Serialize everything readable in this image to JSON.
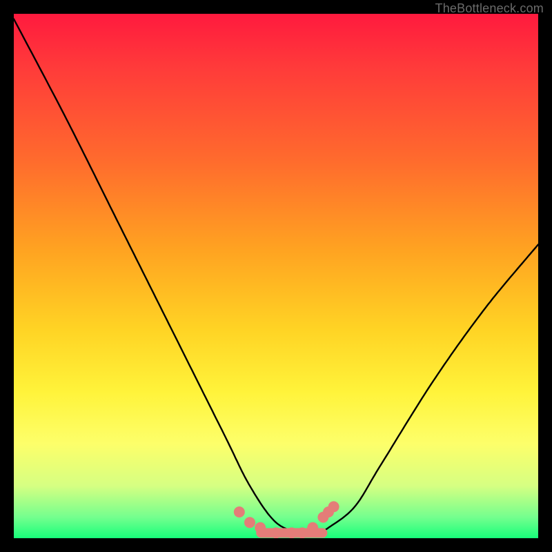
{
  "watermark": "TheBottleneck.com",
  "chart_data": {
    "type": "line",
    "title": "",
    "xlabel": "",
    "ylabel": "",
    "xlim": [
      0,
      100
    ],
    "ylim": [
      0,
      100
    ],
    "grid": false,
    "legend": false,
    "series": [
      {
        "name": "bottleneck-curve",
        "x": [
          0,
          10,
          20,
          30,
          40,
          45,
          50,
          55,
          58,
          60,
          65,
          70,
          80,
          90,
          100
        ],
        "values": [
          99,
          80,
          60,
          40,
          20,
          10,
          3,
          1,
          1,
          2,
          6,
          14,
          30,
          44,
          56
        ]
      }
    ],
    "annotations": [
      {
        "name": "marker-cluster",
        "type": "scatter",
        "color": "#e47d78",
        "x": [
          43,
          45,
          47,
          50,
          53,
          55,
          57,
          59,
          60,
          61
        ],
        "values": [
          5,
          3,
          2,
          1,
          1,
          1,
          2,
          4,
          5,
          6
        ]
      }
    ]
  },
  "colors": {
    "curve": "#000000",
    "markers": "#e47d78",
    "frame": "#000000"
  }
}
